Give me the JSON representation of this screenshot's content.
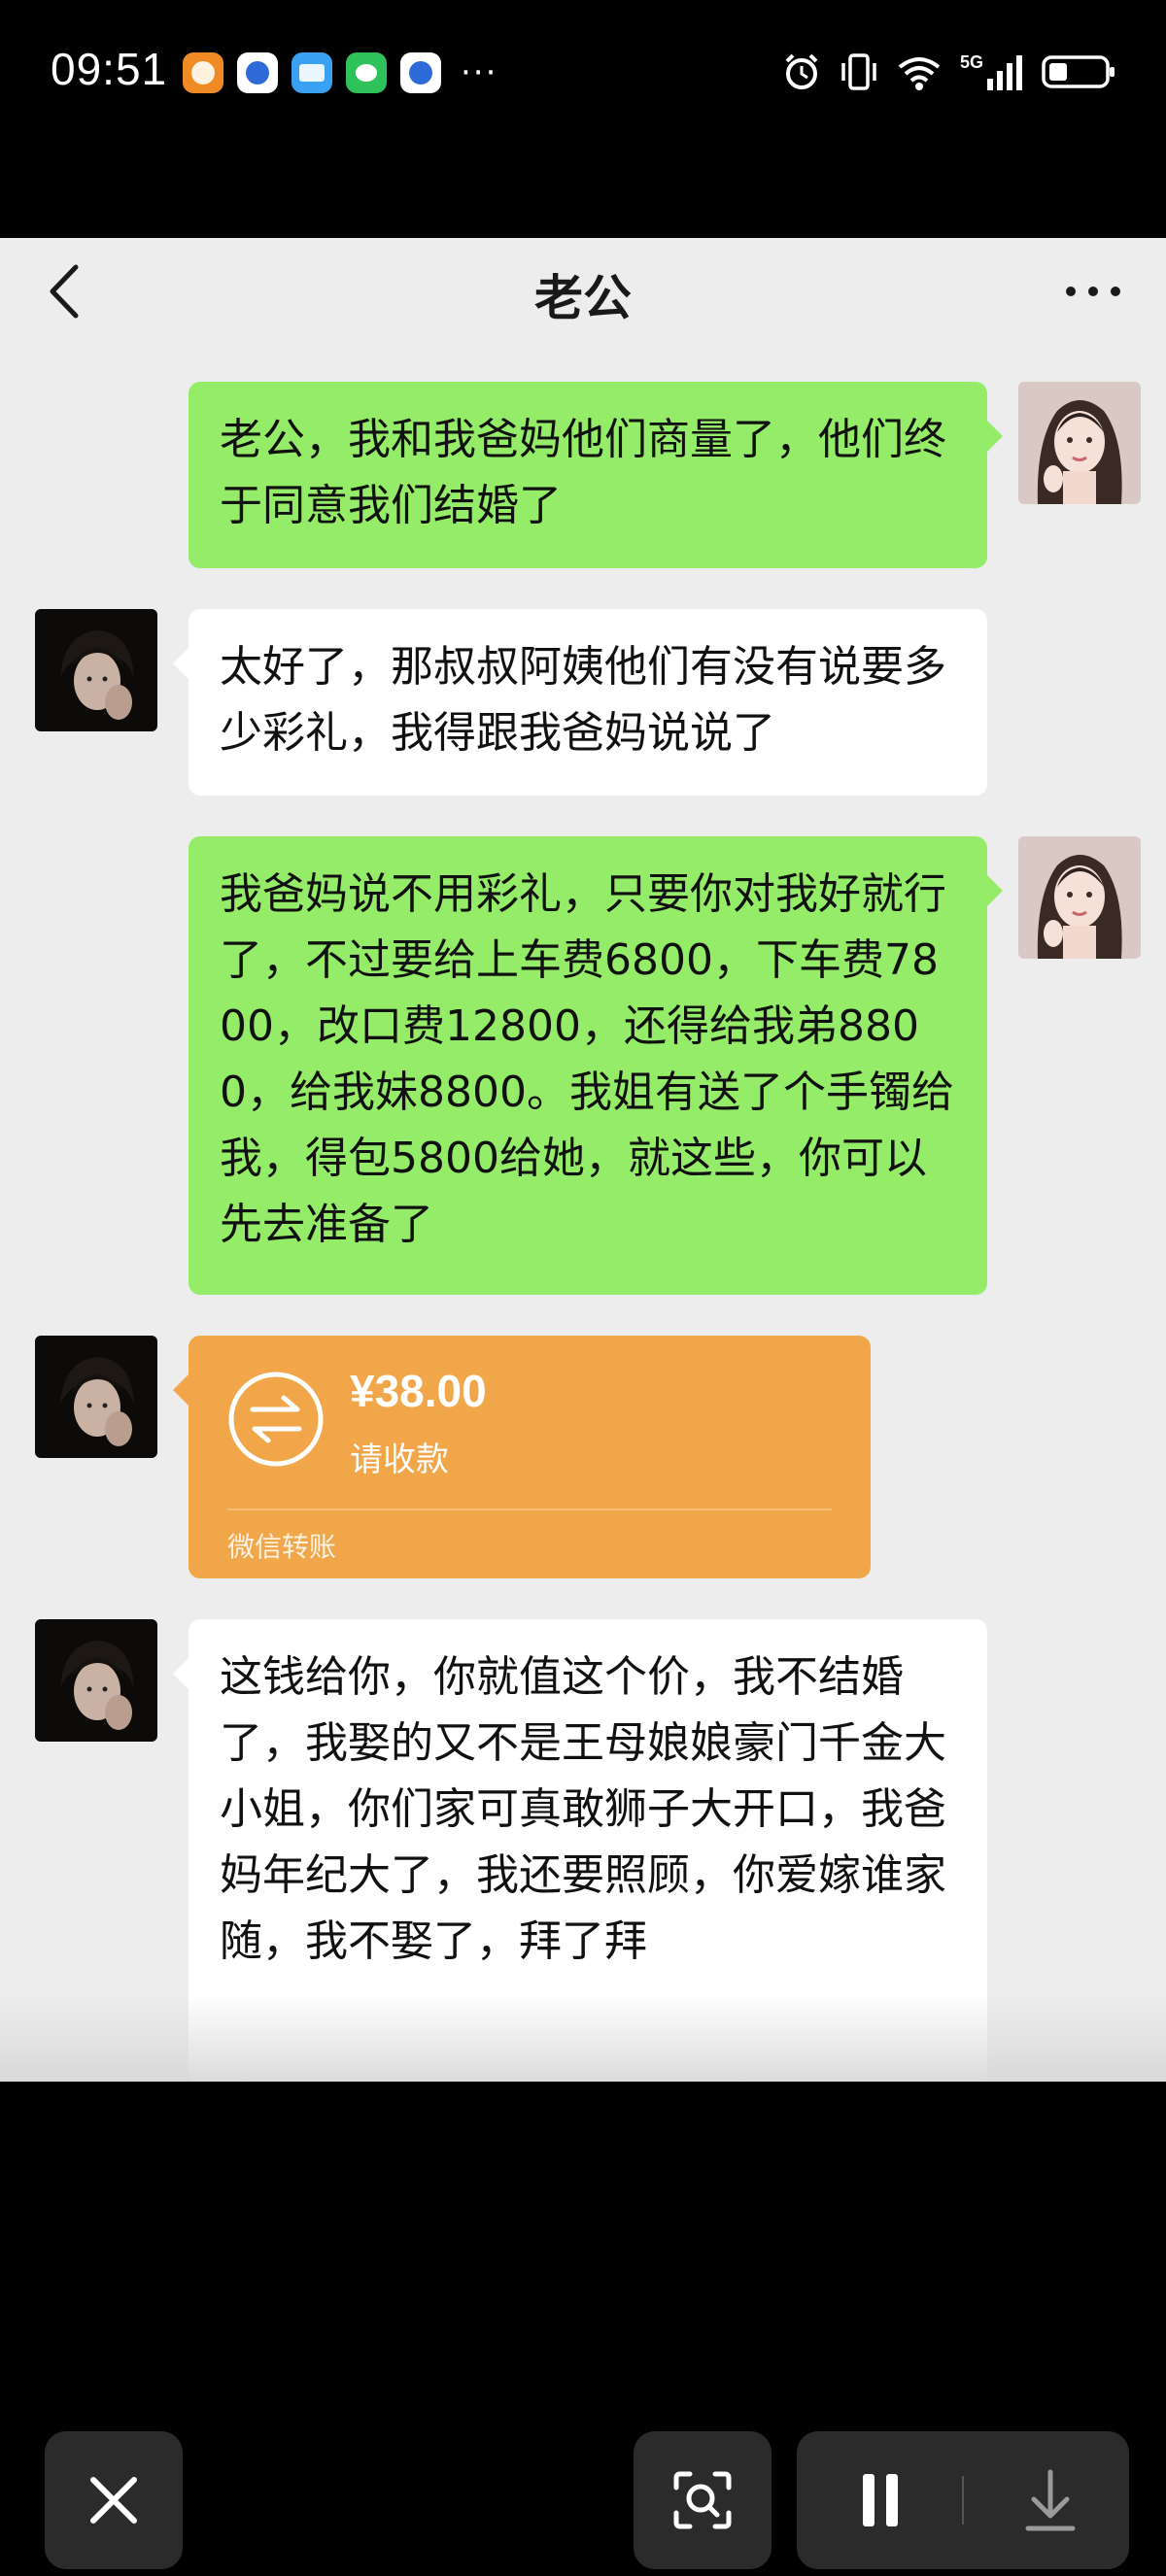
{
  "status_bar": {
    "time": "09:51",
    "network": "5G",
    "app_icons": [
      "taobao-icon",
      "browser-icon",
      "reader-icon",
      "wechat-icon",
      "browser-icon"
    ],
    "system_icons": [
      "alarm-icon",
      "vibrate-icon",
      "wifi-icon",
      "signal-icon",
      "battery-icon"
    ]
  },
  "chat": {
    "title": "老公",
    "messages": [
      {
        "side": "right",
        "type": "text",
        "text": "老公，我和我爸妈他们商量了，他们终于同意我们结婚了"
      },
      {
        "side": "left",
        "type": "text",
        "text": "太好了，那叔叔阿姨他们有没有说要多少彩礼，我得跟我爸妈说说了"
      },
      {
        "side": "right",
        "type": "text",
        "text": "我爸妈说不用彩礼，只要你对我好就行了，不过要给上车费6800，下车费7800，改口费12800，还得给我弟8800，给我妹8800。我姐有送了个手镯给我，得包5800给她，就这些，你可以先去准备了"
      },
      {
        "side": "left",
        "type": "transfer",
        "amount": "¥38.00",
        "status": "请收款",
        "label": "微信转账"
      },
      {
        "side": "left",
        "type": "text",
        "text": "这钱给你，你就值这个价，我不结婚了，我娶的又不是王母娘娘豪门千金大小姐，你们家可真敢狮子大开口，我爸妈年纪大了，我还要照顾，你爱嫁谁家随，我不娶了，拜了拜"
      }
    ]
  },
  "controls": {
    "buttons": [
      "close-icon",
      "scan-icon",
      "pause-icon",
      "download-icon"
    ]
  },
  "colors": {
    "chat_background": "#ededed",
    "sent_bubble": "#95ec69",
    "received_bubble": "#ffffff",
    "transfer_card": "#f0a649"
  }
}
